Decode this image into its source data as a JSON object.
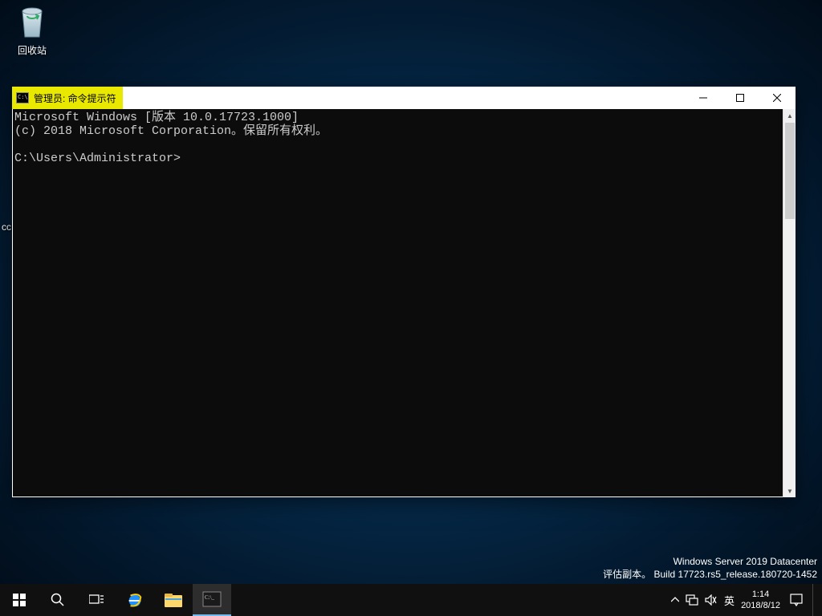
{
  "desktop": {
    "recycle_bin": {
      "label": "回收站"
    },
    "truncated_icon_label": "cc"
  },
  "window": {
    "title": "管理员: 命令提示符",
    "terminal": {
      "line1": "Microsoft Windows [版本 10.0.17723.1000]",
      "line2": "(c) 2018 Microsoft Corporation。保留所有权利。",
      "blank": "",
      "prompt": "C:\\Users\\Administrator>"
    }
  },
  "watermark": {
    "line1": "Windows Server 2019 Datacenter",
    "line2": "评估副本。 Build 17723.rs5_release.180720-1452"
  },
  "taskbar": {
    "ime": "英",
    "time": "1:14",
    "date": "2018/8/12"
  }
}
